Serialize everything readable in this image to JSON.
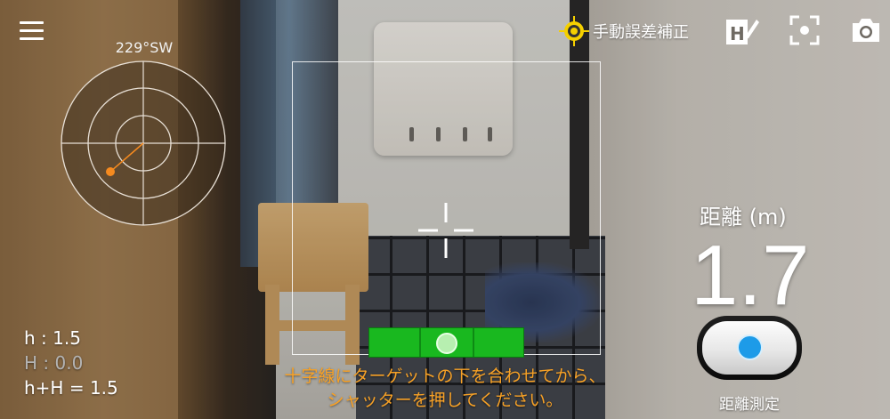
{
  "compass": {
    "heading": "229°SW"
  },
  "toolbar": {
    "manual_correction_label": "手動誤差補正",
    "icons": [
      "menu-icon",
      "target-icon",
      "height-edit-icon",
      "focus-icon",
      "camera-icon"
    ]
  },
  "heights": {
    "h": "h : 1.5",
    "H": "H : 0.0",
    "sum": "h+H = 1.5"
  },
  "level": {
    "position": 0.5
  },
  "instruction": {
    "line1": "十字線にターゲットの下を合わせてから、",
    "line2": "シャッターを押してください。"
  },
  "distance": {
    "label": "距離 (m)",
    "value": "1.7"
  },
  "measure_button": {
    "label": "距離測定"
  },
  "colors": {
    "accent_orange": "#f7a126",
    "level_green": "#19b81f",
    "button_blue": "#1d9be8",
    "target_yellow": "#f5d000"
  }
}
